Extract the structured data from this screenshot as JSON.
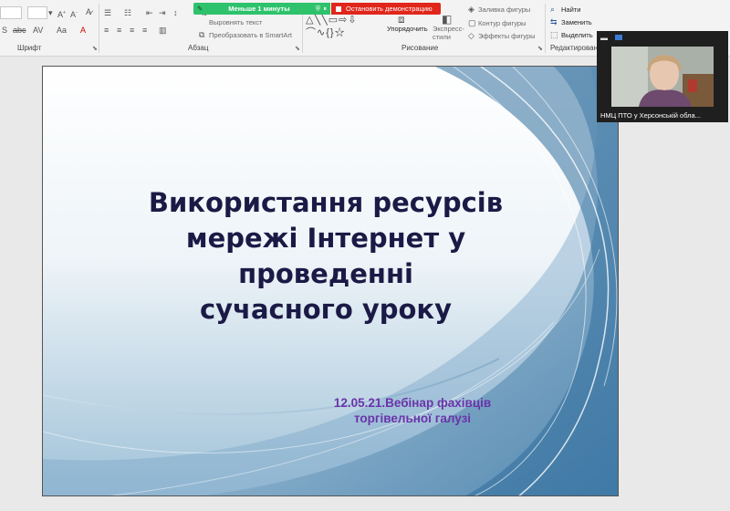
{
  "share_bar": {
    "timer_text": "Меньше 1 минуты",
    "stop_label": "Остановить демонстрацию"
  },
  "ribbon": {
    "font": {
      "group_label": "Шрифт",
      "size_value": ""
    },
    "paragraph": {
      "group_label": "Абзац",
      "align_text": "Выровнять текст",
      "smartart": "Преобразовать в SmartArt"
    },
    "drawing": {
      "group_label": "Рисование",
      "arrange": "Упорядочить",
      "quick_styles": "Экспресс-стили",
      "shape_fill": "Заливка фигуры",
      "shape_outline": "Контур фигуры",
      "shape_effects": "Эффекты фигуры"
    },
    "editing": {
      "group_label": "Редактирование",
      "find": "Найти",
      "replace": "Заменить",
      "select": "Выделить"
    }
  },
  "slide": {
    "title": "Використання ресурсів\nмережі Інтернет у\nпроведенні\nсучасного уроку",
    "subtitle": "12.05.21.Вебінар фахівців\nторгівельної галузі"
  },
  "video": {
    "participant_name": "НМЦ ПТО у Херсонській обла..."
  },
  "colors": {
    "title": "#1b1a46",
    "subtitle": "#6a34a8",
    "share_green": "#2dc26b",
    "share_red": "#e0261b"
  }
}
